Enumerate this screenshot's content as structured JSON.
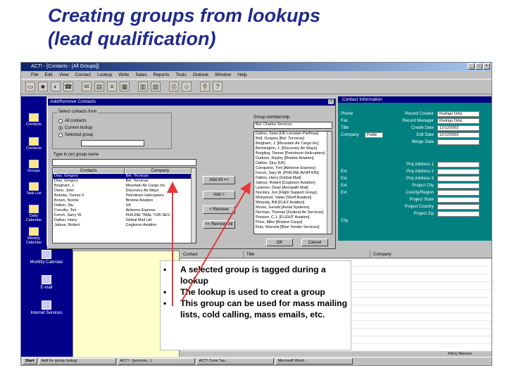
{
  "slide": {
    "title_line1": "Creating groups from lookups",
    "title_line2": "(lead qualification)"
  },
  "app": {
    "window_title": "ACT! - [Contacts - [All Groups]]",
    "menu": [
      "File",
      "Edit",
      "View",
      "Contact",
      "Lookup",
      "Write",
      "Sales",
      "Reports",
      "Tools",
      "Outlook",
      "Window",
      "Help"
    ],
    "window_buttons": [
      "_",
      "□",
      "×"
    ]
  },
  "sidebar": {
    "items": [
      "Contacts",
      "Contacts",
      "Groups",
      "Task List",
      "Daily Calendar",
      "Weekly Calendar"
    ]
  },
  "outlook_bar": {
    "items": [
      "Monthly Calendar",
      "E-mail",
      "Internet Services"
    ]
  },
  "detail_panel": {
    "header": "Contact Information",
    "left_labels": [
      "Phone",
      "Fax",
      "Title",
      "Company",
      "Ext",
      "Ext",
      "Ext",
      "Ext",
      "City"
    ],
    "public_label": "Public",
    "right_fields": [
      {
        "label": "Record Creator",
        "value": "Rodrigo Ortiz"
      },
      {
        "label": "Record Manager",
        "value": "Rodrigo Ortiz"
      },
      {
        "label": "Create Date",
        "value": "12/12/2002"
      },
      {
        "label": "Edit Date",
        "value": "12/12/2002"
      },
      {
        "label": "Merge Date",
        "value": ""
      },
      {
        "label": "Proj Address 1",
        "value": ""
      },
      {
        "label": "Proj Address 2",
        "value": ""
      },
      {
        "label": "Proj Address 3",
        "value": ""
      },
      {
        "label": "Project City",
        "value": ""
      },
      {
        "label": "County/Region",
        "value": ""
      },
      {
        "label": "Project State",
        "value": ""
      },
      {
        "label": "Project Country",
        "value": ""
      },
      {
        "label": "Project Zip",
        "value": ""
      }
    ]
  },
  "dialog": {
    "title": "Add/Remove Contacts",
    "close": "×",
    "select_group_label": "Select contacts from",
    "radios": [
      {
        "label": "All contacts",
        "checked": false
      },
      {
        "label": "Current lookup",
        "checked": true
      },
      {
        "label": "Selected group",
        "checked": false
      }
    ],
    "type_in_label": "Type in (or) group name",
    "col_contacts": "Contacts",
    "col_company": "Company",
    "group_members_label": "Group membership",
    "group_name": "Bel. Charter Services",
    "buttons": {
      "add_all": "Add All >>",
      "add": "Add >",
      "remove": "< Remove",
      "remove_all": "<< Remove All",
      "ok": "OK",
      "cancel": "Cancel"
    },
    "contacts": [
      {
        "name": "Diaz, Gregory",
        "company": "Bel. Tecnicas",
        "selected": true
      },
      {
        "name": "Diaz, Gregory",
        "company": "Bel. Tecnicas",
        "selected": false
      },
      {
        "name": "Bingham, J.",
        "company": "Mountain Air Cargo Inc",
        "selected": false
      },
      {
        "name": "Denn, John",
        "company": "Discovery Air Ways",
        "selected": false
      },
      {
        "name": "Birkeby, Tanner F.",
        "company": "Petroleum Helicopters",
        "selected": false
      },
      {
        "name": "Brown, Norine",
        "company": "Bristow Aviation",
        "selected": false
      },
      {
        "name": "Dalton, Stu",
        "company": "UK",
        "selected": false
      },
      {
        "name": "Concilio, Ton",
        "company": "Airborne Express",
        "selected": false
      },
      {
        "name": "Fench, Sarry W.",
        "company": "PHILINE TMAL TUR-SEV",
        "selected": false
      },
      {
        "name": "Dalton, Harry",
        "company": "Global Mail Ltd",
        "selected": false
      },
      {
        "name": "Jabour, Robert",
        "company": "Ceglexon Aviation",
        "selected": false
      }
    ],
    "members": [
      "Dalton, Sean [UK Lorsstan-Parfmau]",
      "Bell, Gregory [Bel. Tecnicas]",
      "Bingham, J. [Mountain Air Cargo Inc]",
      "Bennington, J. [Discovery Air Ways]",
      "Borgling, Tanner [Petroleum Helicopters]",
      "Dudoon, Rayley [Bristow Aviation]",
      "Dalton, Stuy [UK]",
      "Conqueso, Toni [Airborne Express]",
      "Fench, Sary W. [PHILINE AVIATION]",
      "Dalton, Harry [Global Mail]",
      "Jabour, Robert [Ceglexon Aviation]",
      "Leamen, Dean [Aeropath Mail]",
      "Nocloiry, Jon [Flight Support Group]",
      "Mohamed, Vatan [Shelf Aviation]",
      "Miranda, Bill [FLEX Aviation]",
      "Morse, Gerald [Aerial Systems]",
      "Norman, Thomas [Federal Air Services]",
      "Preston, C.J. [FLIGHT Aviation]",
      "Price, Mike [Bristow Cargo]",
      "Ruiz, Marcela [Blue Yonder Services]"
    ]
  },
  "grid": {
    "headers": [
      "Contact",
      "Title",
      "Company"
    ]
  },
  "status": {
    "user": "Kilroy Benson"
  },
  "taskbar": {
    "start": "Start",
    "tasks": [
      "Add for group lookup",
      "ACT! - [process...]",
      "ACT! Cons Tas...",
      "Microsoft Word..."
    ]
  },
  "callout": {
    "bullets": [
      "A selected group is tagged during a lookup",
      "The lookup is used to creat a group",
      "This group can be used for mass mailing lists, cold calling, mass emails, etc."
    ]
  },
  "colors": {
    "title": "#1f2a8a",
    "arrow": "#e8373a",
    "sidebar": "#00008b",
    "detail_bg": "#008080",
    "selection": "#000080"
  }
}
